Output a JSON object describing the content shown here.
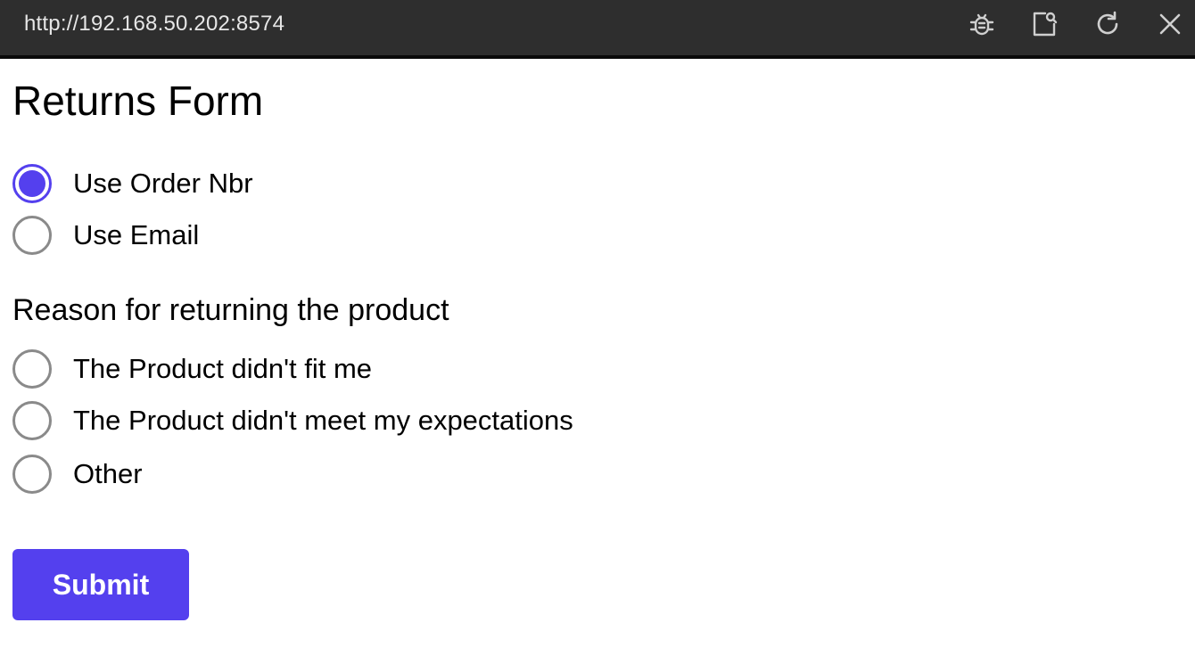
{
  "browser": {
    "url": "http://192.168.50.202:8574",
    "icons": [
      "bug-icon",
      "screenshot-icon",
      "reload-icon",
      "close-icon"
    ]
  },
  "form": {
    "title": "Returns Form",
    "lookup_options": [
      {
        "label": "Use Order Nbr",
        "checked": true
      },
      {
        "label": "Use Email",
        "checked": false
      }
    ],
    "reason_label": "Reason for returning the product",
    "reason_options": [
      {
        "label": "The Product didn't fit me",
        "checked": false
      },
      {
        "label": "The Product didn't meet my expectations",
        "checked": false
      },
      {
        "label": "Other",
        "checked": false
      }
    ],
    "submit_label": "Submit"
  },
  "colors": {
    "accent": "#5440ee",
    "topbar": "#2e2e2e",
    "radio_border": "#8a8a8a"
  }
}
